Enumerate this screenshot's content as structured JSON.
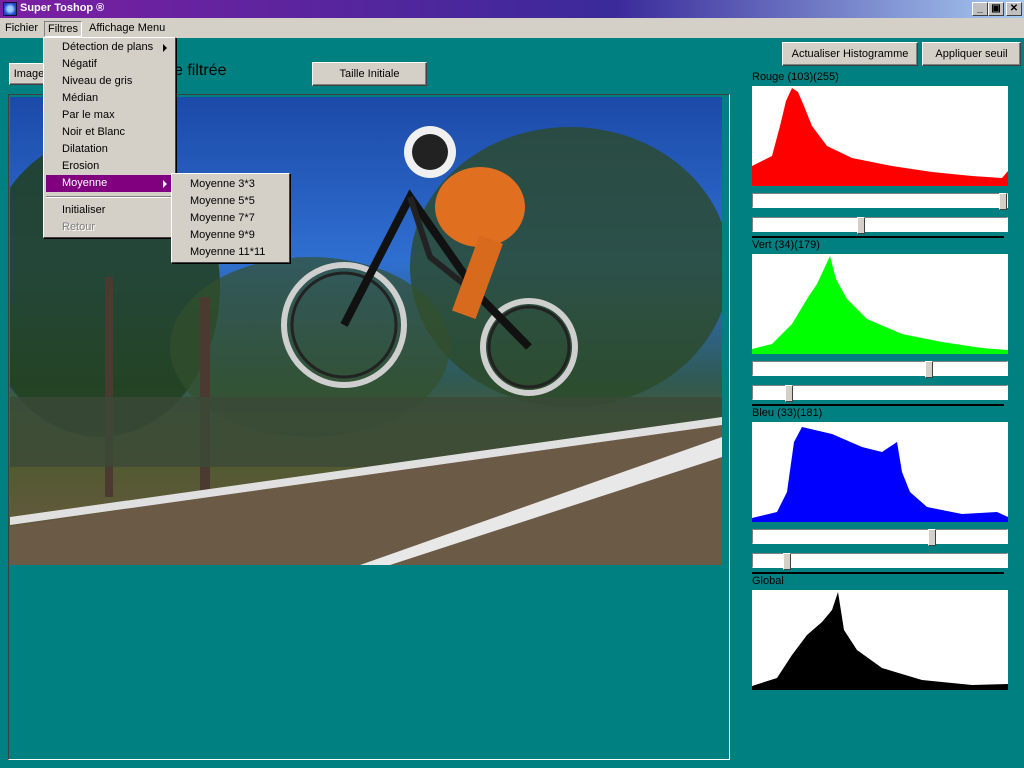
{
  "window": {
    "title": "Super Toshop ®",
    "minimize": "_",
    "restore": "▣",
    "close": "✕"
  },
  "menubar": {
    "fichier": "Fichier",
    "filtres": "Filtres",
    "affichage": "Affichage Menu"
  },
  "toolbar": {
    "image_button": "Image",
    "heading": "e filtrée",
    "taille_initiale": "Taille Initiale",
    "actualiser_histogramme": "Actualiser Histogramme",
    "appliquer_seuil": "Appliquer seuil"
  },
  "histograms": {
    "rouge": {
      "label": "Rouge (103)(255)",
      "color": "#ff0000"
    },
    "vert": {
      "label": "Vert (34)(179)",
      "color": "#00ff00"
    },
    "bleu": {
      "label": "Bleu (33)(181)",
      "color": "#0000ff"
    },
    "global": {
      "label": "Global",
      "color": "#000000"
    }
  },
  "filtres_menu": {
    "items": [
      "Détection de plans",
      "Négatif",
      "Niveau de gris",
      "Médian",
      "Par le max",
      "Noir et Blanc",
      "Dilatation",
      "Erosion",
      "Moyenne",
      "Initialiser",
      "Retour"
    ]
  },
  "moyenne_submenu": {
    "items": [
      "Moyenne 3*3",
      "Moyenne 5*5",
      "Moyenne 7*7",
      "Moyenne 9*9",
      "Moyenne 11*11"
    ]
  },
  "colors": {
    "background": "#008080",
    "menu_highlight": "#800080",
    "face": "#d4d0c8"
  }
}
